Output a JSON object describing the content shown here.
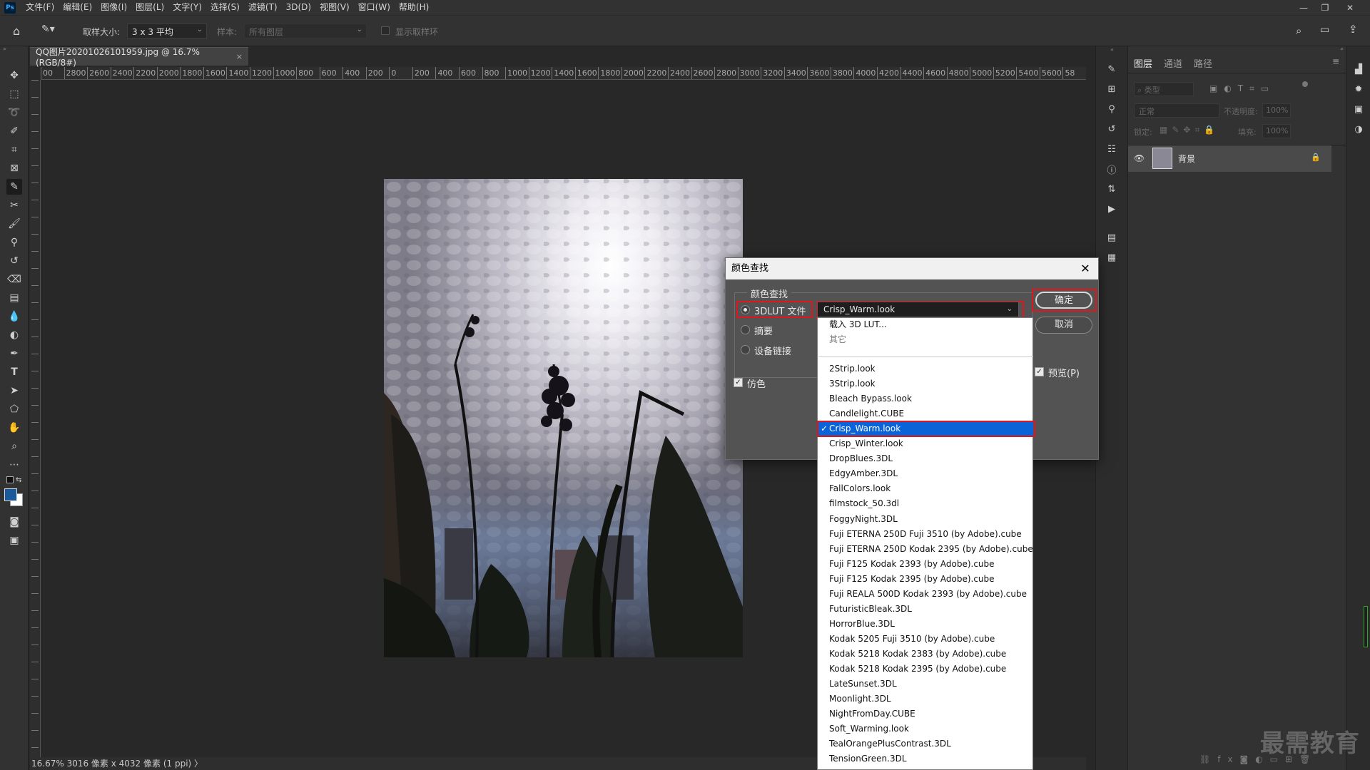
{
  "menubar": {
    "app_logo": "Ps",
    "items": [
      "文件(F)",
      "编辑(E)",
      "图像(I)",
      "图层(L)",
      "文字(Y)",
      "选择(S)",
      "滤镜(T)",
      "3D(D)",
      "视图(V)",
      "窗口(W)",
      "帮助(H)"
    ],
    "window_controls": [
      "minimize-icon",
      "restore-icon",
      "close-icon"
    ]
  },
  "options_bar": {
    "sample_size_label": "取样大小:",
    "sample_size_value": "3 x 3 平均",
    "sample_label": "样本:",
    "sample_value": "所有图层",
    "show_ring_label": "显示取样环"
  },
  "document": {
    "tab_title": "QQ图片20201026101959.jpg @ 16.7%(RGB/8#)",
    "tab_close": "×",
    "ruler_top_labels": [
      "00",
      "2800",
      "2600",
      "2400",
      "2200",
      "2000",
      "1800",
      "1600",
      "1400",
      "1200",
      "1000",
      "800",
      "600",
      "400",
      "200",
      "0",
      "200",
      "400",
      "600",
      "800",
      "1000",
      "1200",
      "1400",
      "1600",
      "1800",
      "2000",
      "2200",
      "2400",
      "2600",
      "2800",
      "3000",
      "3200",
      "3400",
      "3600",
      "3800",
      "4000",
      "4200",
      "4400",
      "4600",
      "4800",
      "5000",
      "5200",
      "5400",
      "5600",
      "58"
    ],
    "status_text": "16.67%   3016 像素 x 4032 像素 (1 ppi)  〉"
  },
  "layers_panel": {
    "tabs": [
      "图层",
      "通道",
      "路径"
    ],
    "filter_placeholder": "类型",
    "blend_mode": "正常",
    "opacity_label": "不透明度:",
    "opacity_value": "100%",
    "lock_label": "锁定:",
    "fill_label": "填充:",
    "fill_value": "100%",
    "layer_name": "背景"
  },
  "dialog": {
    "title": "颜色查找",
    "close": "✕",
    "group_title": "颜色查找",
    "options": [
      "3DLUT 文件",
      "摘要",
      "设备链接"
    ],
    "selected_option": "3DLUT 文件",
    "lut_value": "Crisp_Warm.look",
    "dither_label": "仿色",
    "ok_label": "确定",
    "cancel_label": "取消",
    "preview_label": "预览(P)"
  },
  "dropdown": {
    "load_item": "载入 3D LUT...",
    "other_item": "其它",
    "items": [
      "2Strip.look",
      "3Strip.look",
      "Bleach Bypass.look",
      "Candlelight.CUBE",
      "Crisp_Warm.look",
      "Crisp_Winter.look",
      "DropBlues.3DL",
      "EdgyAmber.3DL",
      "FallColors.look",
      "filmstock_50.3dl",
      "FoggyNight.3DL",
      "Fuji ETERNA 250D Fuji 3510 (by Adobe).cube",
      "Fuji ETERNA 250D Kodak 2395 (by Adobe).cube",
      "Fuji F125 Kodak 2393 (by Adobe).cube",
      "Fuji F125 Kodak 2395 (by Adobe).cube",
      "Fuji REALA 500D Kodak 2393 (by Adobe).cube",
      "FuturisticBleak.3DL",
      "HorrorBlue.3DL",
      "Kodak 5205 Fuji 3510 (by Adobe).cube",
      "Kodak 5218 Kodak 2383 (by Adobe).cube",
      "Kodak 5218 Kodak 2395 (by Adobe).cube",
      "LateSunset.3DL",
      "Moonlight.3DL",
      "NightFromDay.CUBE",
      "Soft_Warming.look",
      "TealOrangePlusContrast.3DL",
      "TensionGreen.3DL"
    ],
    "selected_index": 4,
    "check": "✓"
  },
  "watermark": "最需教育",
  "colors": {
    "accent_red": "#e0161d",
    "selection_blue": "#0a64d8",
    "foreground_swatch": "#1a5a9a",
    "background_swatch": "#ffffff"
  }
}
